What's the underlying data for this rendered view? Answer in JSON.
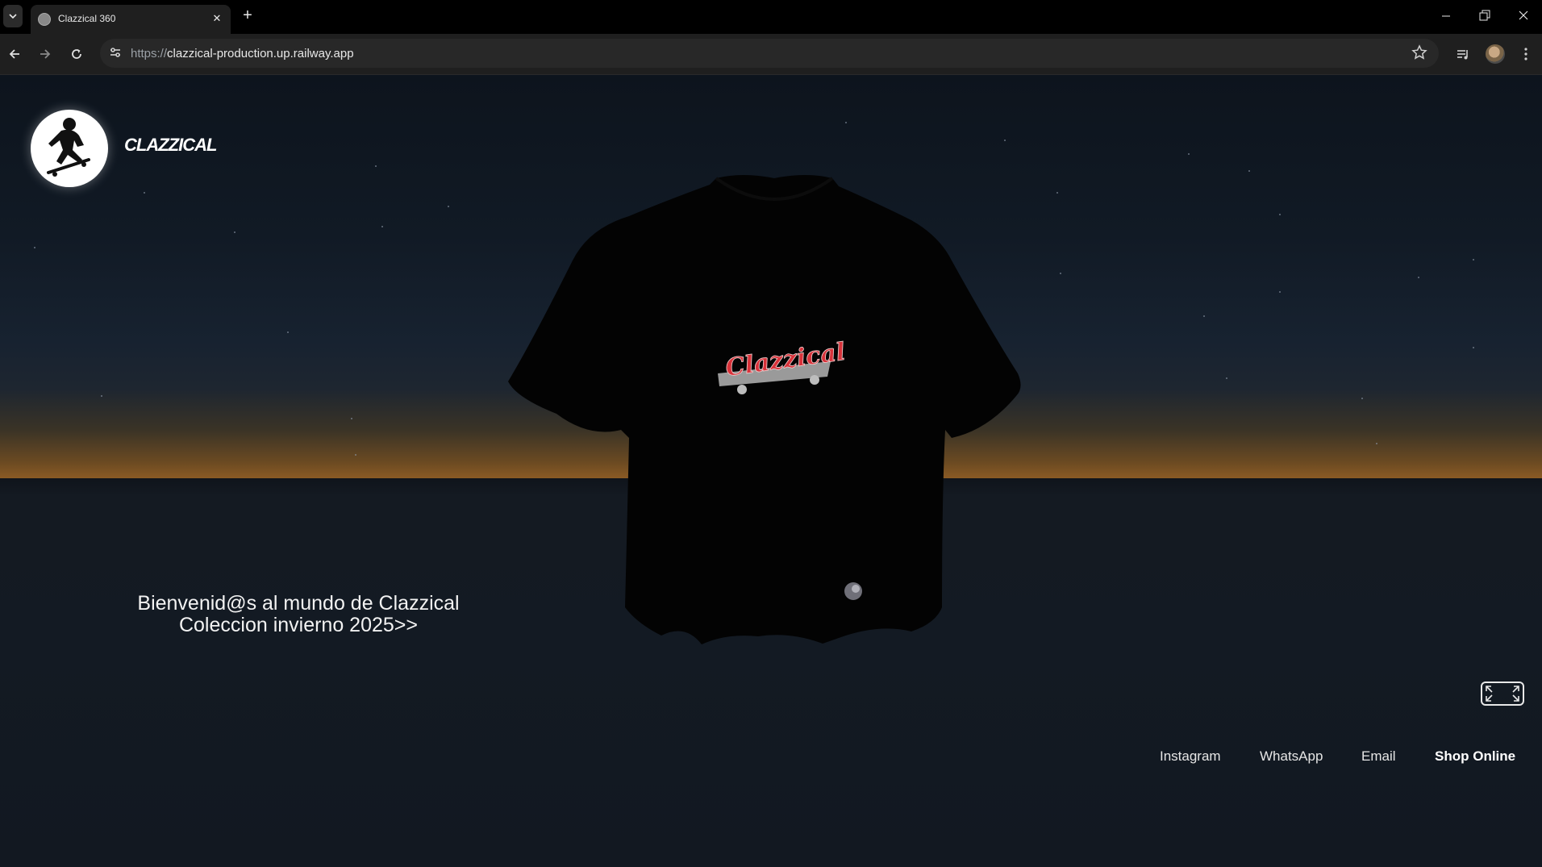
{
  "browser": {
    "tab_title": "Clazzical 360",
    "url_scheme": "https://",
    "url_host": "clazzical-production.up.railway.app"
  },
  "site": {
    "brand": "CLAZZICAL",
    "shirt_print": "Clazzical",
    "welcome_line1": "Bienvenid@s al mundo de Clazzical",
    "welcome_line2": "Coleccion invierno 2025>>",
    "footer_links": [
      "Instagram",
      "WhatsApp",
      "Email",
      "Shop Online"
    ]
  },
  "colors": {
    "sky_top": "#0d141d",
    "sunset_glow": "#8a5a24",
    "text": "#f2f2f2",
    "print_red": "#d8323a"
  }
}
